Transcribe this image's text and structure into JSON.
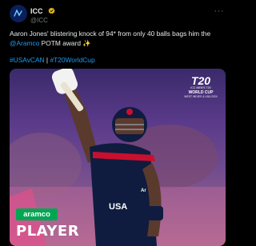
{
  "tweet": {
    "author": {
      "display_name": "ICC",
      "handle": "@ICC"
    },
    "more_label": "···",
    "text": {
      "part1": "Aaron Jones' blistering knock of 94* from only 40 balls bags him the ",
      "mention": "@Aramco",
      "part2": " POTM award ✨"
    },
    "hashtags": [
      "#USAvCAN",
      "#T20WorldCup"
    ],
    "hashtag_separator": " | "
  },
  "media": {
    "badge": "aramco",
    "headline": "PLAYER",
    "logo": {
      "mark": "T20",
      "line1": "ICC MEN'S T20",
      "line2": "WORLD CUP",
      "line3": "WEST INDIES & USA 2024"
    },
    "jersey_text": "USA"
  },
  "colors": {
    "background": "#000000",
    "link": "#1d9bf0",
    "text": "#e7e9ea",
    "muted": "#71767b",
    "verified": "#e2b719",
    "aramco_green": "#00a651"
  },
  "icons": [
    "icc-avatar-icon",
    "verified-badge-icon",
    "more-options-icon"
  ]
}
